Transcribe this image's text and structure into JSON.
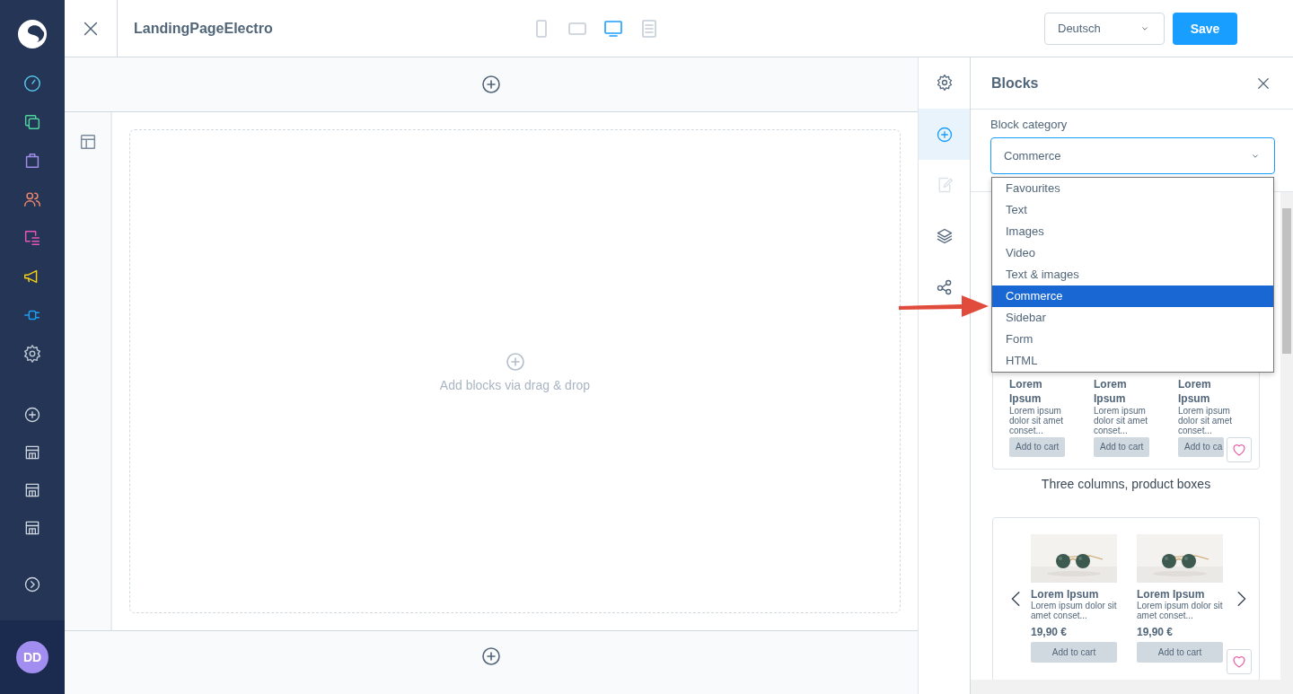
{
  "user": {
    "initials": "DD"
  },
  "header": {
    "title": "LandingPageElectro",
    "devices": [
      {
        "kind": "phone",
        "selected": false
      },
      {
        "kind": "tablet",
        "selected": false
      },
      {
        "kind": "desktop",
        "selected": true
      },
      {
        "kind": "form",
        "selected": false
      }
    ],
    "language": "Deutsch",
    "save_button": "Save"
  },
  "canvas": {
    "hint": "Add blocks via drag & drop"
  },
  "sidebar_tabs": [
    {
      "kind": "settings",
      "selected": false,
      "disabled": false
    },
    {
      "kind": "add",
      "selected": true,
      "disabled": false
    },
    {
      "kind": "edit",
      "selected": false,
      "disabled": true
    },
    {
      "kind": "layers",
      "selected": false,
      "disabled": false
    },
    {
      "kind": "share",
      "selected": false,
      "disabled": false
    }
  ],
  "blocks_panel": {
    "title": "Blocks",
    "category_label": "Block category",
    "category_value": "Commerce",
    "options": [
      {
        "label": "Favourites",
        "selected": false
      },
      {
        "label": "Text",
        "selected": false
      },
      {
        "label": "Images",
        "selected": false
      },
      {
        "label": "Video",
        "selected": false
      },
      {
        "label": "Text & images",
        "selected": false
      },
      {
        "label": "Commerce",
        "selected": true
      },
      {
        "label": "Sidebar",
        "selected": false
      },
      {
        "label": "Form",
        "selected": false
      },
      {
        "label": "HTML",
        "selected": false
      }
    ],
    "blocks": [
      {
        "kind": "columns",
        "caption": "Three columns, product boxes",
        "products": [
          {
            "title": "Lorem Ipsum",
            "description": "Lorem ipsum dolor sit amet conset...",
            "button": "Add to cart"
          },
          {
            "title": "Lorem Ipsum",
            "description": "Lorem ipsum dolor sit amet conset...",
            "button": "Add to cart"
          },
          {
            "title": "Lorem Ipsum",
            "description": "Lorem ipsum dolor sit amet conset...",
            "button": "Add to ca"
          }
        ]
      },
      {
        "kind": "slider",
        "products": [
          {
            "title": "Lorem Ipsum",
            "description": "Lorem ipsum dolor sit amet conset...",
            "price": "19,90 €",
            "button": "Add to cart"
          },
          {
            "title": "Lorem Ipsum",
            "description": "Lorem ipsum dolor sit amet conset...",
            "price": "19,90 €",
            "button": "Add to cart"
          }
        ]
      }
    ]
  }
}
